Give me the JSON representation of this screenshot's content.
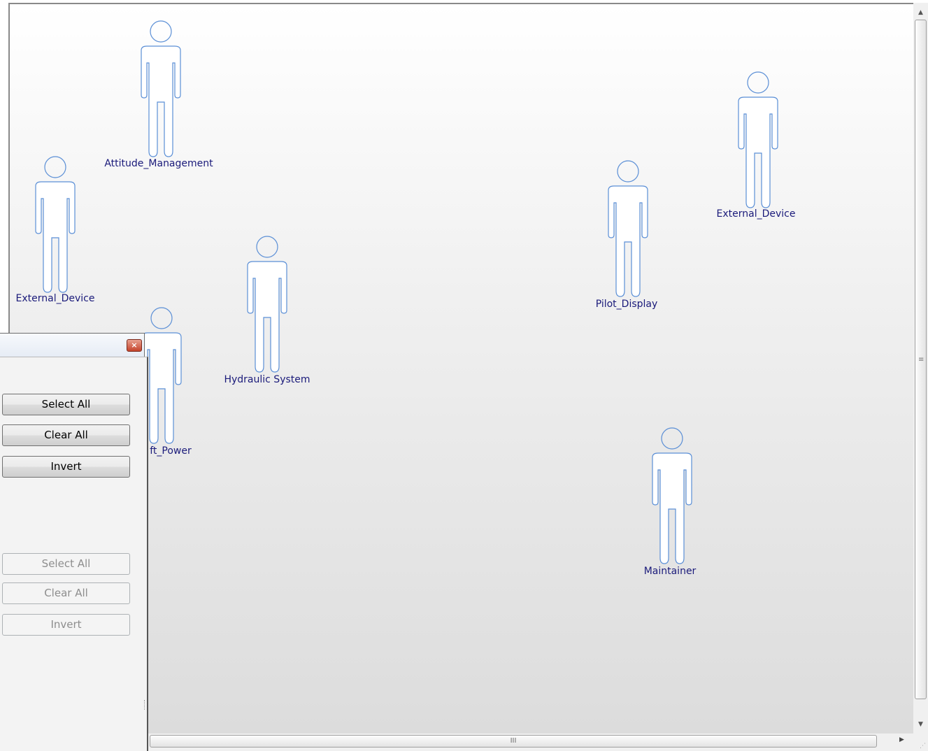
{
  "diagram": {
    "actors": [
      {
        "label": "Attitude_Management"
      },
      {
        "label": "External_Device"
      },
      {
        "label": "Hydraulic System"
      },
      {
        "label": "ft_Power"
      },
      {
        "label": "Pilot_Display"
      },
      {
        "label": "External_Device"
      },
      {
        "label": "Maintainer"
      }
    ]
  },
  "panel": {
    "close_icon": "close-icon",
    "group1": {
      "select_all": "Select All",
      "clear_all": "Clear All",
      "invert": "Invert"
    },
    "group2": {
      "select_all": "Select All",
      "clear_all": "Clear All",
      "invert": "Invert"
    }
  },
  "scrollbars": {
    "horizontal_grip": "III",
    "vertical_grip": "≡"
  },
  "colors": {
    "actor_outline": "#5b8fd6",
    "label_text": "#1a1a7a"
  }
}
